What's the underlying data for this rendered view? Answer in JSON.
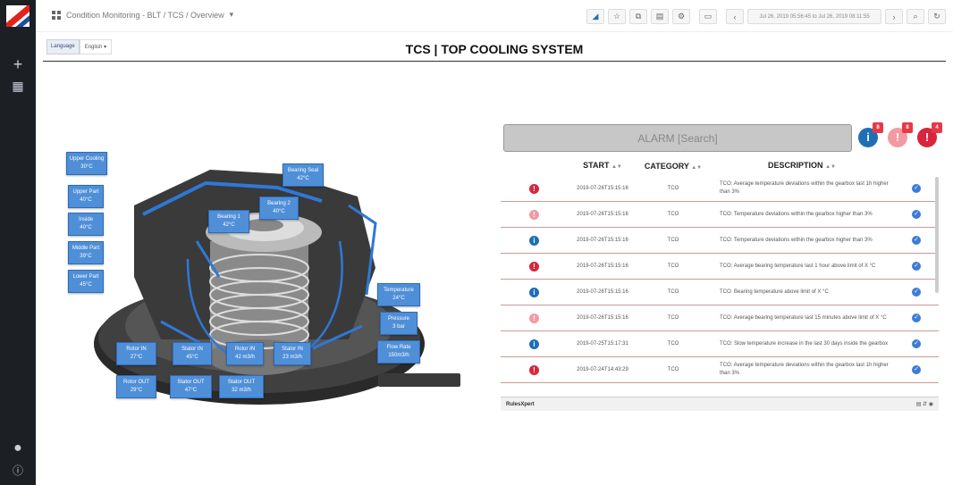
{
  "breadcrumb": "Condition Monitoring - BLT / TCS / Overview",
  "toolbar": {
    "time_range": "Jul 26, 2019 05:56:45 to Jul 26, 2019 08:11:55",
    "buttons": [
      "share",
      "star",
      "copy",
      "save",
      "settings",
      "tv",
      "back",
      "forward",
      "zoom",
      "refresh"
    ]
  },
  "language": {
    "label": "Language",
    "selected": "English"
  },
  "title": "TCS | TOP COOLING SYSTEM",
  "sensors": [
    {
      "id": "upper-cooling",
      "name": "Upper Cooling",
      "value": "30°C"
    },
    {
      "id": "upper-part",
      "name": "Upper Part",
      "value": "40°C"
    },
    {
      "id": "inside",
      "name": "Inside",
      "value": "40°C"
    },
    {
      "id": "middle-part",
      "name": "Middle Part",
      "value": "39°C"
    },
    {
      "id": "lower-part",
      "name": "Lower Part",
      "value": "45°C"
    },
    {
      "id": "bearing-seal",
      "name": "Bearing Seal",
      "value": "42°C"
    },
    {
      "id": "bearing-2",
      "name": "Bearing 2",
      "value": "40°C"
    },
    {
      "id": "bearing-1",
      "name": "Bearing 1",
      "value": "42°C"
    },
    {
      "id": "temperature",
      "name": "Temperature",
      "value": "24°C"
    },
    {
      "id": "pressure",
      "name": "Pressure",
      "value": "3 bar"
    },
    {
      "id": "flow-rate",
      "name": "Flow Rate",
      "value": "150m3/h"
    },
    {
      "id": "rotor-in",
      "name": "Rotor IN",
      "value": "27°C"
    },
    {
      "id": "stator-in",
      "name": "Stator IN",
      "value": "45°C"
    },
    {
      "id": "rotor-in-flow",
      "name": "Rotor IN",
      "value": "42 m3/h"
    },
    {
      "id": "stator-in-flow",
      "name": "Stator IN",
      "value": "23 m3/h"
    },
    {
      "id": "rotor-out",
      "name": "Rotor OUT",
      "value": "29°C"
    },
    {
      "id": "stator-out",
      "name": "Stator OUT",
      "value": "47°C"
    },
    {
      "id": "stator-out-flow",
      "name": "Stator OUT",
      "value": "32 m3/h"
    }
  ],
  "alarm": {
    "search_placeholder": "ALARM [Search]",
    "badges": [
      {
        "type": "info",
        "glyph": "i",
        "count": "8",
        "color": "#1f6fb5"
      },
      {
        "type": "warning",
        "glyph": "!",
        "count": "8",
        "color": "#f29aa3"
      },
      {
        "type": "error",
        "glyph": "!",
        "count": "4",
        "color": "#d7263d"
      }
    ],
    "columns": {
      "start": "START",
      "category": "CATEGORY",
      "description": "DESCRIPTION"
    },
    "sort_glyph": "▲▼",
    "rows": [
      {
        "severity": "error",
        "color": "#d7263d",
        "glyph": "!",
        "start": "2019-07-26T15:15:16",
        "category": "TCO",
        "description": "TCO: Average temperature deviations within the gearbox last 1h higher than 3%"
      },
      {
        "severity": "warning",
        "color": "#f29aa3",
        "glyph": "!",
        "start": "2019-07-26T15:15:16",
        "category": "TCO",
        "description": "TCO: Temperature deviations within the gearbox higher than 3%"
      },
      {
        "severity": "info",
        "color": "#1f6fb5",
        "glyph": "i",
        "start": "2019-07-26T15:15:16",
        "category": "TCO",
        "description": "TCO: Temperature deviations within the gearbox higher than 3%"
      },
      {
        "severity": "error",
        "color": "#d7263d",
        "glyph": "!",
        "start": "2019-07-26T15:15:16",
        "category": "TCO",
        "description": "TCO: Average bearing temperature last 1 hour above limit of X °C"
      },
      {
        "severity": "info",
        "color": "#1f6fb5",
        "glyph": "i",
        "start": "2019-07-26T15:15:16",
        "category": "TCO",
        "description": "TCO: Bearing temperature above limit of X °C"
      },
      {
        "severity": "warning",
        "color": "#f29aa3",
        "glyph": "!",
        "start": "2019-07-26T15:15:16",
        "category": "TCO",
        "description": "TCO: Average bearing temperature last 15 minutes above limit of X °C"
      },
      {
        "severity": "info",
        "color": "#1f6fb5",
        "glyph": "i",
        "start": "2019-07-25T15:17:31",
        "category": "TCO",
        "description": "TCO: Slow temperature increase in the last 30 days inside the gearbox"
      },
      {
        "severity": "error",
        "color": "#d7263d",
        "glyph": "!",
        "start": "2019-07-24T14:43:29",
        "category": "TCO",
        "description": "TCO: Average temperature deviations within the gearbox last 1h higher than 3%"
      }
    ],
    "footer_label": "RulesXpert"
  }
}
